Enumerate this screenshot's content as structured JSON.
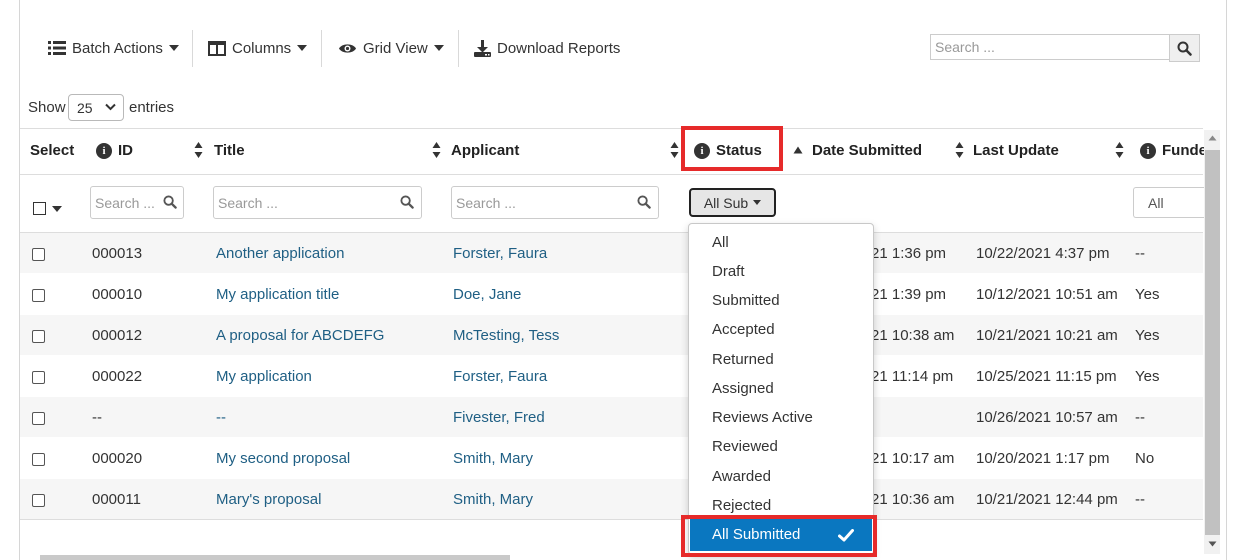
{
  "toolbar": {
    "batch_actions": "Batch Actions",
    "columns": "Columns",
    "grid_view": "Grid View",
    "download_reports": "Download Reports"
  },
  "search": {
    "placeholder": "Search ..."
  },
  "length": {
    "show_label": "Show",
    "value": "25",
    "entries_label": "entries"
  },
  "table": {
    "headers": {
      "select": "Select",
      "id": "ID",
      "title": "Title",
      "applicant": "Applicant",
      "status": "Status",
      "date_submitted": "Date Submitted",
      "last_update": "Last Update",
      "funded": "Funde"
    },
    "filters": {
      "id_placeholder": "Search ...",
      "title_placeholder": "Search ...",
      "applicant_placeholder": "Search ...",
      "status_value": "All Sub",
      "funded_value": "All"
    },
    "rows": [
      {
        "id": "000013",
        "title": "Another application",
        "applicant": "Forster, Faura",
        "date_submitted": "21 1:36 pm",
        "last_update": "10/22/2021 4:37 pm",
        "funded": "--"
      },
      {
        "id": "000010",
        "title": "My application title",
        "applicant": "Doe, Jane",
        "date_submitted": "21 1:39 pm",
        "last_update": "10/12/2021 10:51 am",
        "funded": "Yes"
      },
      {
        "id": "000012",
        "title": "A proposal for ABCDEFG",
        "applicant": "McTesting, Tess",
        "date_submitted": "21 10:38 am",
        "last_update": "10/21/2021 10:21 am",
        "funded": "Yes"
      },
      {
        "id": "000022",
        "title": "My application",
        "applicant": "Forster, Faura",
        "date_submitted": "21 11:14 pm",
        "last_update": "10/25/2021 11:15 pm",
        "funded": "Yes"
      },
      {
        "id": "--",
        "title": "--",
        "applicant": "Fivester, Fred",
        "date_submitted": "",
        "last_update": "10/26/2021 10:57 am",
        "funded": "--"
      },
      {
        "id": "000020",
        "title": "My second proposal",
        "applicant": "Smith, Mary",
        "date_submitted": "21 10:17 am",
        "last_update": "10/20/2021 1:17 pm",
        "funded": "No"
      },
      {
        "id": "000011",
        "title": "Mary's proposal",
        "applicant": "Smith, Mary",
        "date_submitted": "21 10:36 am",
        "last_update": "10/21/2021 12:44 pm",
        "funded": "--"
      }
    ]
  },
  "status_dropdown": {
    "options": [
      "All",
      "Draft",
      "Submitted",
      "Accepted",
      "Returned",
      "Assigned",
      "Reviews Active",
      "Reviewed",
      "Awarded",
      "Rejected"
    ],
    "selected": "All Submitted"
  },
  "colors": {
    "link": "#1f5f84",
    "highlight": "#e62a2a",
    "selected": "#0a77c0"
  }
}
